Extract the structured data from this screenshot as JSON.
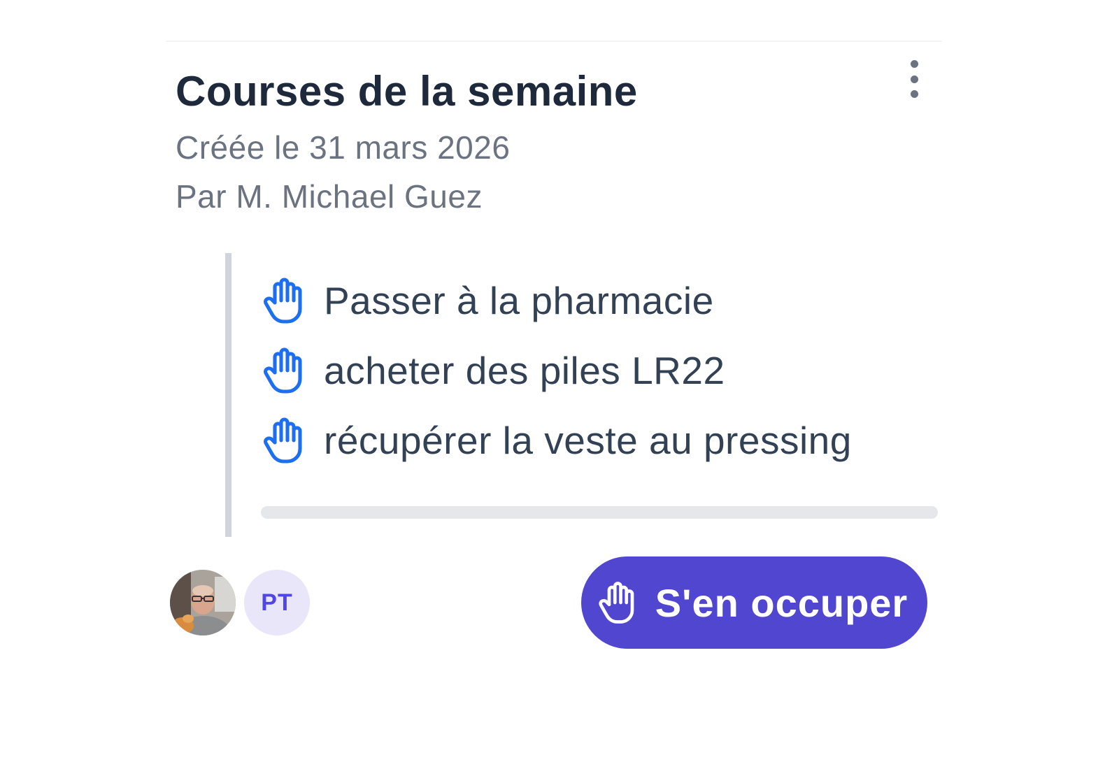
{
  "card": {
    "title": "Courses de la semaine",
    "created": "Créée le 31 mars 2026",
    "author": "Par M. Michael Guez",
    "menu_icon": "more-vertical-icon"
  },
  "tasks": [
    {
      "label": "Passer à la pharmacie",
      "icon": "hand-icon"
    },
    {
      "label": "acheter des piles LR22",
      "icon": "hand-icon"
    },
    {
      "label": "récupérer la veste au pressing",
      "icon": "hand-icon"
    }
  ],
  "progress": {
    "completed_fraction": 0
  },
  "participants": [
    {
      "type": "photo"
    },
    {
      "type": "initials",
      "initials": "PT"
    }
  ],
  "action": {
    "label": "S'en occuper",
    "icon": "hand-icon"
  },
  "colors": {
    "accent": "#4f46e5",
    "button": "#5046d0",
    "task_icon": "#1d6ff2",
    "title": "#1e293b",
    "muted": "#6b7280"
  }
}
